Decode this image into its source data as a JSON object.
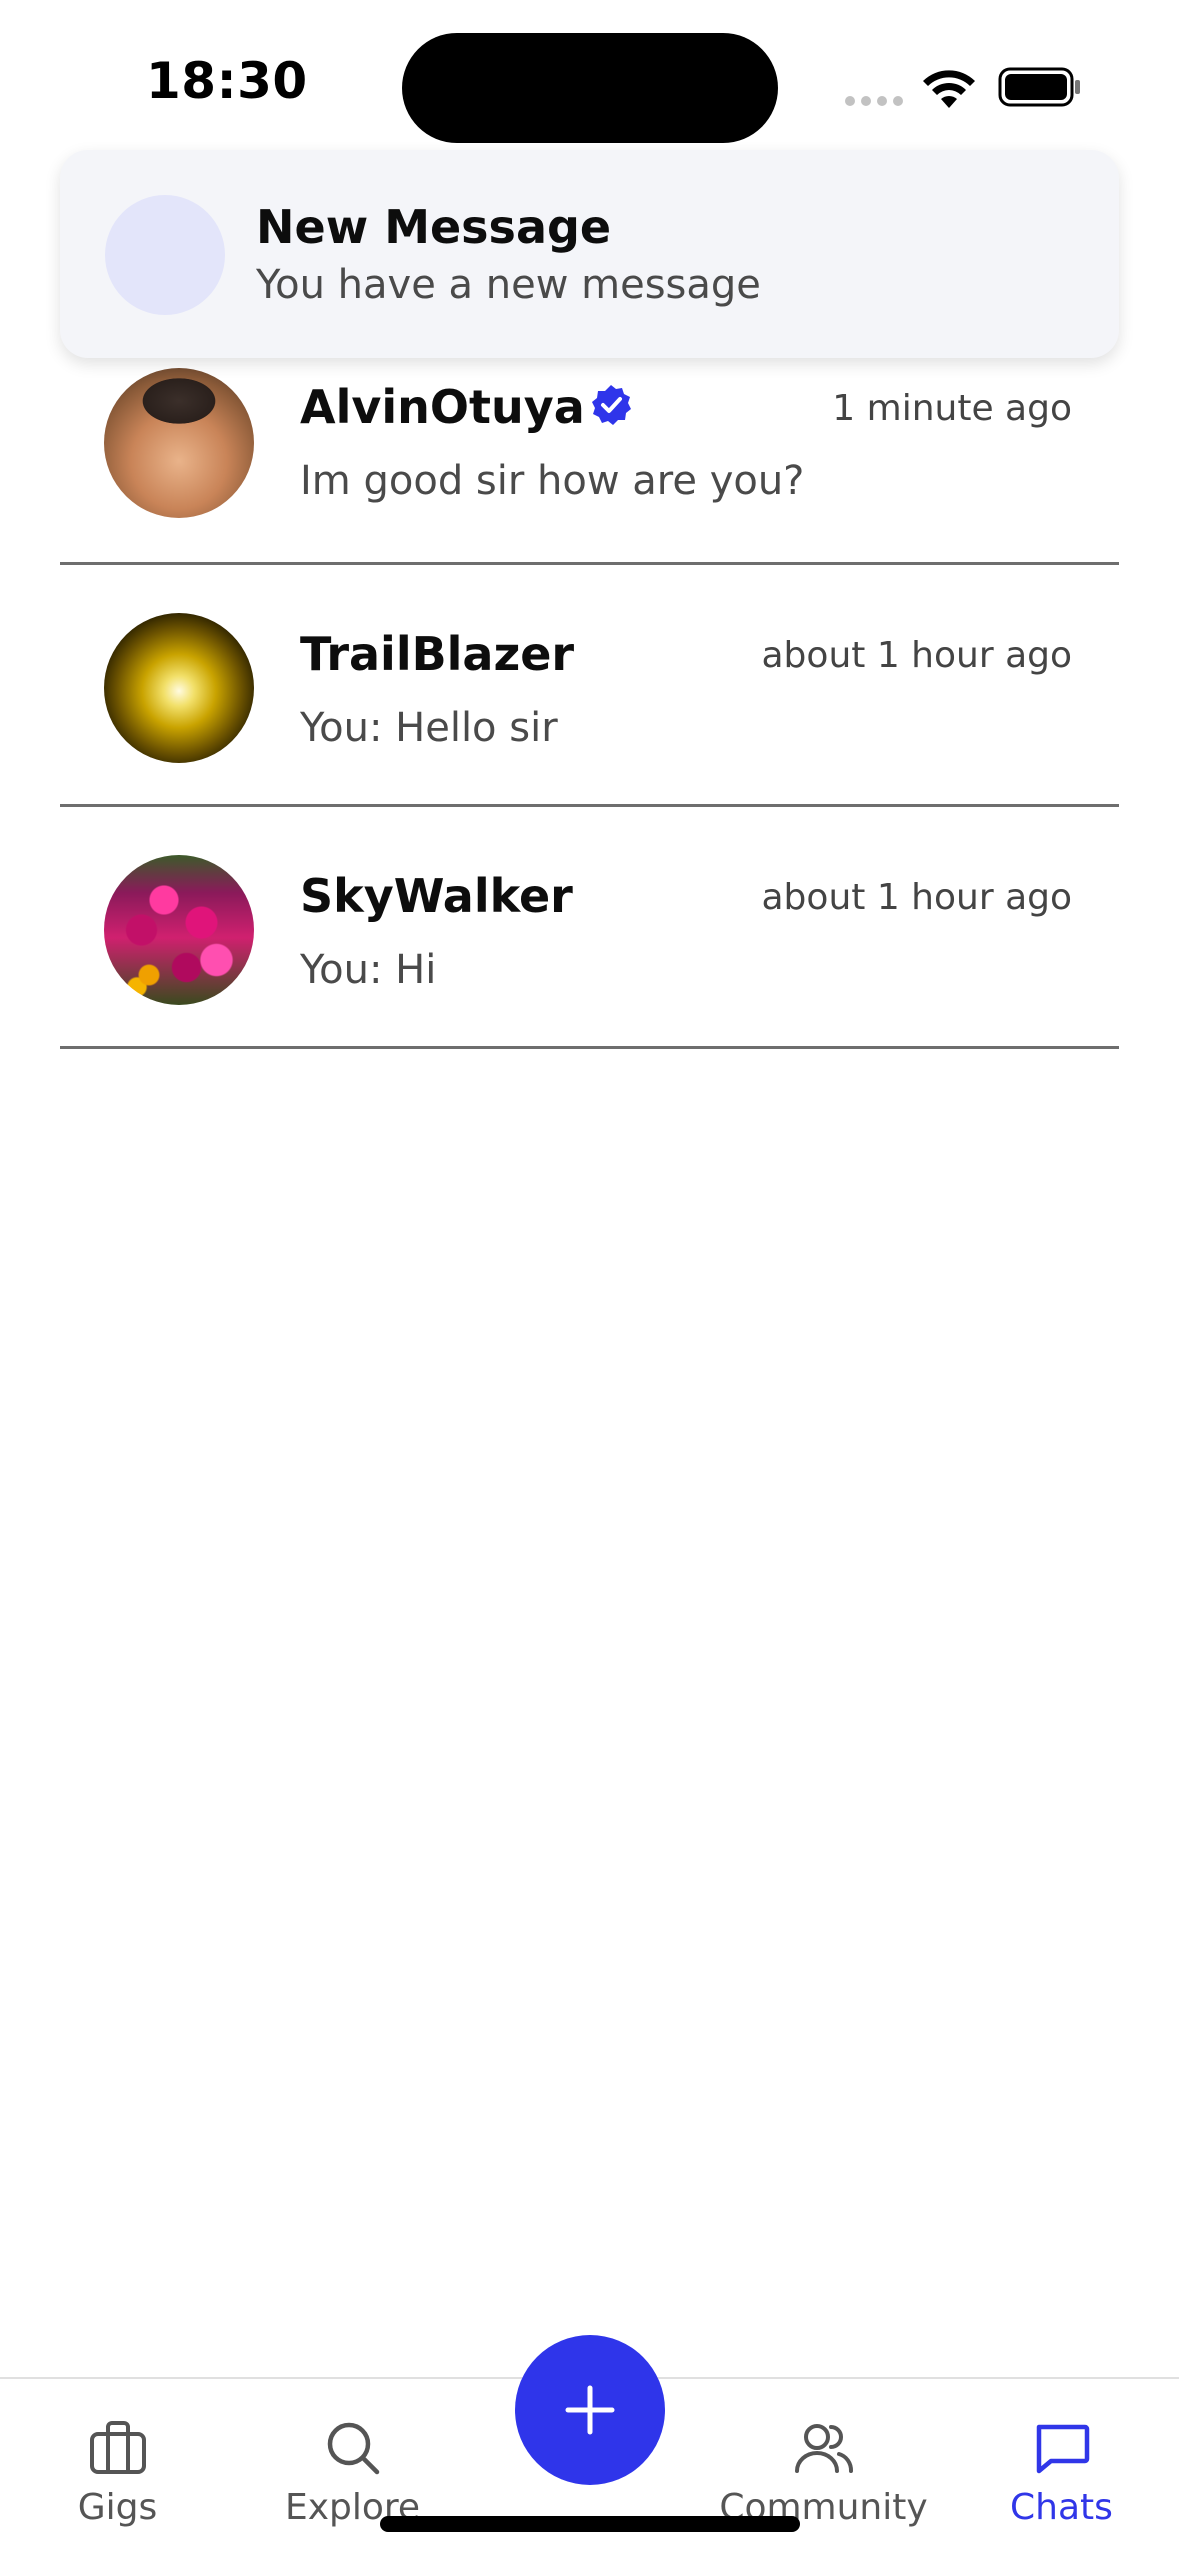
{
  "status_bar": {
    "time": "18:30"
  },
  "notification": {
    "title": "New Message",
    "body": "You have a new message"
  },
  "chats": [
    {
      "name": "AlvinOtuya",
      "verified": true,
      "time": "1 minute ago",
      "preview": "Im good sir how are you?",
      "avatar": "cat-photo"
    },
    {
      "name": "TrailBlazer",
      "verified": false,
      "time": "about 1 hour ago",
      "preview": "You: Hello sir",
      "avatar": "glowing-orb-photo"
    },
    {
      "name": "SkyWalker",
      "verified": false,
      "time": "about 1 hour ago",
      "preview": "You: Hi",
      "avatar": "flowers-photo"
    }
  ],
  "nav": {
    "items": [
      {
        "label": "Gigs",
        "icon": "briefcase-icon"
      },
      {
        "label": "Explore",
        "icon": "search-icon"
      },
      {
        "label": "Community",
        "icon": "users-icon"
      },
      {
        "label": "Chats",
        "icon": "chat-bubble-icon",
        "active": true
      }
    ],
    "fab_icon": "plus-icon"
  },
  "colors": {
    "accent": "#2f35ea",
    "divider": "#6e6e6e",
    "notification_bg": "#f4f5f9"
  }
}
